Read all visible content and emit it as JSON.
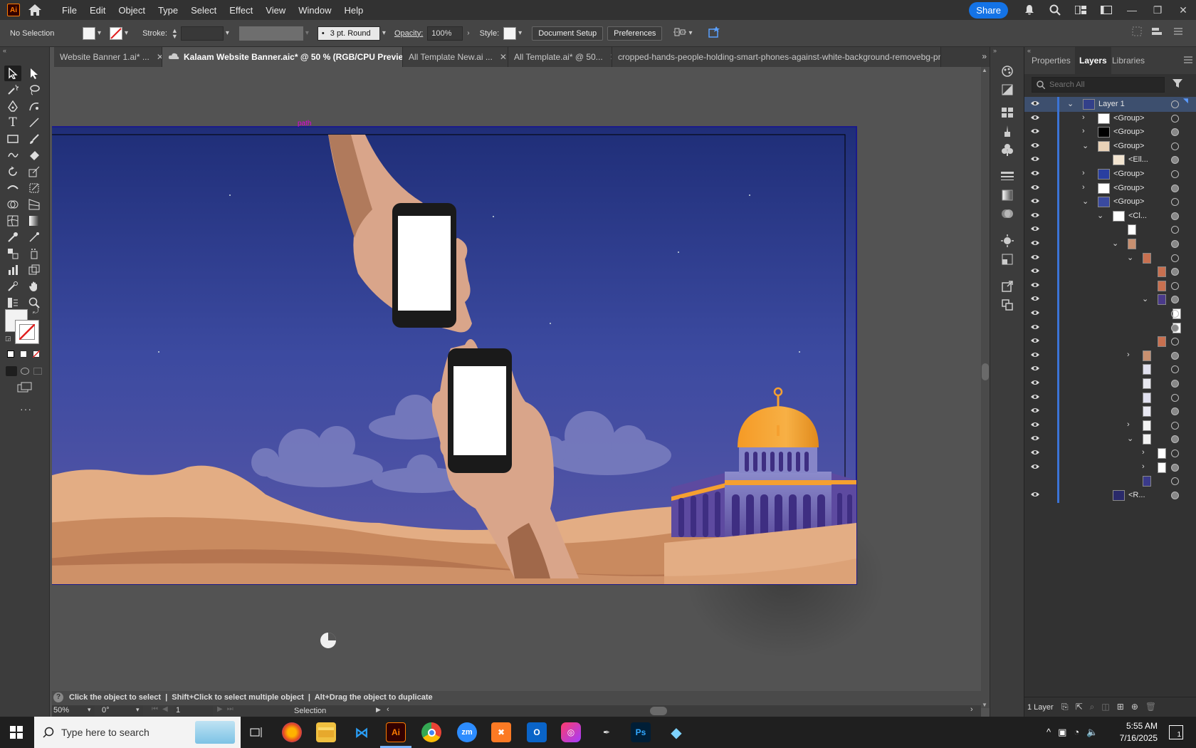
{
  "app": {
    "logo": "Ai",
    "menu": [
      "File",
      "Edit",
      "Object",
      "Type",
      "Select",
      "Effect",
      "View",
      "Window",
      "Help"
    ],
    "share_label": "Share",
    "brand_color": "#ff7c00",
    "accent_color": "#1473e6"
  },
  "control": {
    "selection": "No Selection",
    "stroke_label": "Stroke:",
    "brush": "3 pt. Round",
    "opacity_label": "Opacity:",
    "opacity_value": "100%",
    "style_label": "Style:",
    "document_setup": "Document Setup",
    "preferences": "Preferences"
  },
  "tabs": [
    {
      "label": "Website Banner 1.ai* ...",
      "close": "✕"
    },
    {
      "label": "Kalaam Website Banner.aic* @ 50 % (RGB/CPU Preview)",
      "close": "✕"
    },
    {
      "label": "All Template New.ai ...",
      "close": "✕"
    },
    {
      "label": "All Template.ai* @ 50...",
      "close": "✕"
    },
    {
      "label": "cropped-hands-people-holding-smart-phones-against-white-background-removebg-pr",
      "close": ""
    }
  ],
  "canvas": {
    "path_label": "path",
    "artboard_bg": "#3c4aa0",
    "sand_color": "#d89d72",
    "dome_color": "#f5a030"
  },
  "panel": {
    "tabs": [
      "Properties",
      "Layers",
      "Libraries"
    ],
    "search_placeholder": "Search All",
    "layer_count": "1 Layer",
    "layers": [
      {
        "name": "Layer 1",
        "indent": 0,
        "twirl": "open"
      },
      {
        "name": "<Group>",
        "indent": 1,
        "twirl": "closed"
      },
      {
        "name": "<Group>",
        "indent": 1,
        "twirl": "closed"
      },
      {
        "name": "<Group>",
        "indent": 1,
        "twirl": "open"
      },
      {
        "name": "<Ell...",
        "indent": 2,
        "twirl": "none"
      },
      {
        "name": "<Group>",
        "indent": 1,
        "twirl": "closed"
      },
      {
        "name": "<Group>",
        "indent": 1,
        "twirl": "closed"
      },
      {
        "name": "<Group>",
        "indent": 1,
        "twirl": "open"
      },
      {
        "name": "<Cl...",
        "indent": 2,
        "twirl": "open"
      },
      {
        "name": "",
        "indent": 3,
        "twirl": "none"
      },
      {
        "name": "",
        "indent": 3,
        "twirl": "open"
      },
      {
        "name": "",
        "indent": 4,
        "twirl": "open"
      },
      {
        "name": "",
        "indent": 5,
        "twirl": "none"
      },
      {
        "name": "",
        "indent": 5,
        "twirl": "none"
      },
      {
        "name": "",
        "indent": 5,
        "twirl": "open"
      },
      {
        "name": "",
        "indent": 6,
        "twirl": "none"
      },
      {
        "name": "",
        "indent": 6,
        "twirl": "none"
      },
      {
        "name": "",
        "indent": 5,
        "twirl": "none"
      },
      {
        "name": "",
        "indent": 4,
        "twirl": "closed"
      },
      {
        "name": "",
        "indent": 4,
        "twirl": "none"
      },
      {
        "name": "",
        "indent": 4,
        "twirl": "none"
      },
      {
        "name": "",
        "indent": 4,
        "twirl": "none"
      },
      {
        "name": "",
        "indent": 4,
        "twirl": "none"
      },
      {
        "name": "",
        "indent": 4,
        "twirl": "closed"
      },
      {
        "name": "",
        "indent": 4,
        "twirl": "open"
      },
      {
        "name": "",
        "indent": 5,
        "twirl": "closed"
      },
      {
        "name": "",
        "indent": 5,
        "twirl": "closed"
      },
      {
        "name": "",
        "indent": 4,
        "twirl": "none"
      },
      {
        "name": "<R...",
        "indent": 2,
        "twirl": "none"
      }
    ]
  },
  "status": {
    "hint": "Click the object to select  |  Shift+Click to select multiple object  |  Alt+Drag the object to duplicate",
    "zoom": "50%",
    "rotation": "0°",
    "artboard": "1",
    "tool": "Selection"
  },
  "taskbar": {
    "search_placeholder": "Type here to search",
    "time": "5:55 AM",
    "date": "7/16/2025",
    "notifications": "1"
  }
}
